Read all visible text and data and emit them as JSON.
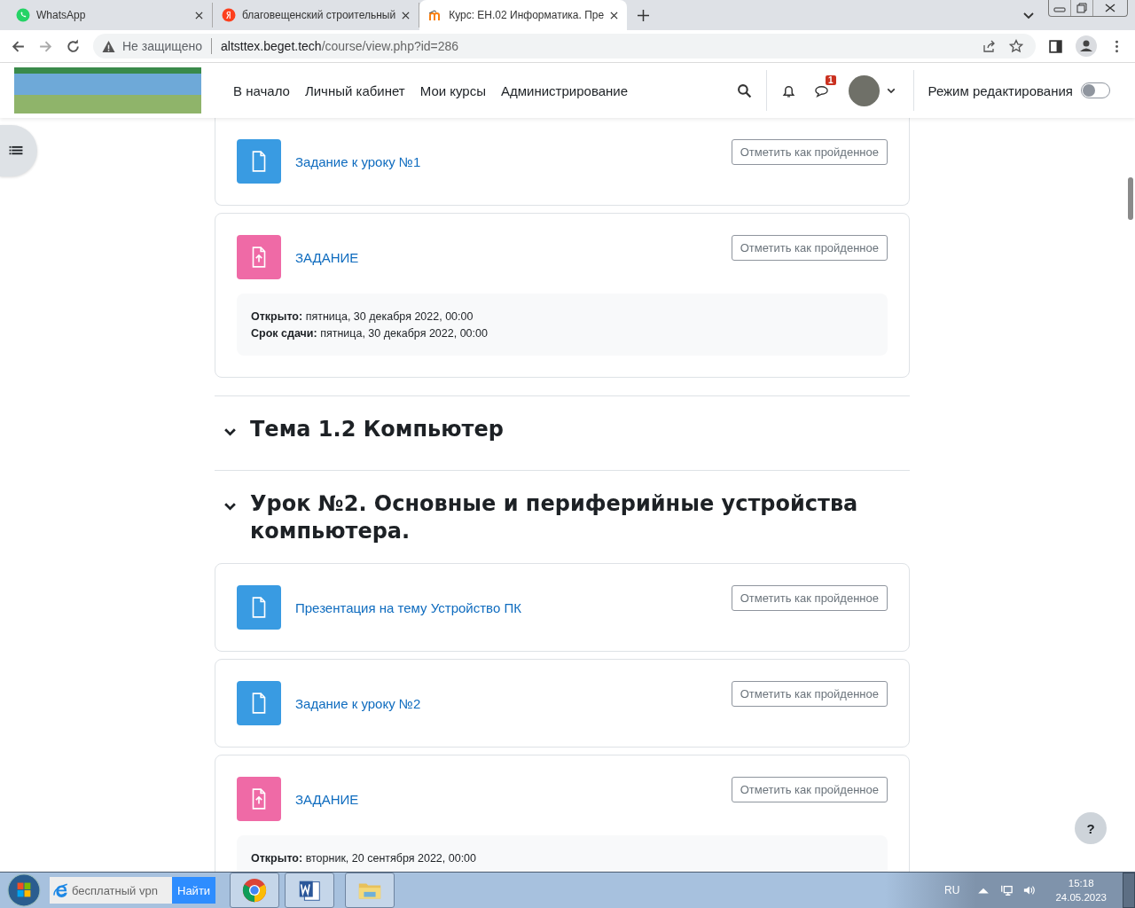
{
  "browser": {
    "tabs": [
      {
        "title": "WhatsApp",
        "selected": false
      },
      {
        "title": "благовещенский строительный",
        "selected": false
      },
      {
        "title": "Курс: ЕН.02 Информатика. Пре",
        "selected": true
      }
    ],
    "address": {
      "security": "Не защищено",
      "host": "altsttex.beget.tech",
      "path": "/course/view.php?id=286"
    }
  },
  "header": {
    "nav": [
      "В начало",
      "Личный кабинет",
      "Мои курсы",
      "Администрирование"
    ],
    "messages_badge": "1",
    "edit_mode": {
      "label": "Режим редактирования",
      "on": false
    }
  },
  "course": [
    {
      "kind": "page",
      "title": "Задание к уроку №1",
      "button": "Отметить как пройденное"
    },
    {
      "kind": "assign",
      "title": "ЗАДАНИЕ",
      "button": "Отметить как пройденное",
      "dates": [
        {
          "label": "Открыто:",
          "value": "пятница, 30 декабря 2022, 00:00"
        },
        {
          "label": "Срок сдачи:",
          "value": "пятница, 30 декабря 2022, 00:00"
        }
      ]
    },
    {
      "kind": "section",
      "title": "Тема 1.2 Компьютер",
      "expanded": true
    },
    {
      "kind": "section",
      "title": "Урок №2. Основные и периферийные устройства компьютера.",
      "expanded": true
    },
    {
      "kind": "page",
      "title": "Презентация на тему Устройство ПК",
      "button": "Отметить как пройденное"
    },
    {
      "kind": "page",
      "title": "Задание к уроку №2",
      "button": "Отметить как пройденное"
    },
    {
      "kind": "assign",
      "title": "ЗАДАНИЕ",
      "button": "Отметить как пройденное",
      "dates": [
        {
          "label": "Открыто:",
          "value": "вторник, 20 сентября 2022, 00:00"
        }
      ]
    }
  ],
  "help_button": "?",
  "taskbar": {
    "search": {
      "placeholder": "бесплатный vpn"
    },
    "search_button": "Найти",
    "language": "RU",
    "time": "15:18",
    "date": "24.05.2023"
  }
}
